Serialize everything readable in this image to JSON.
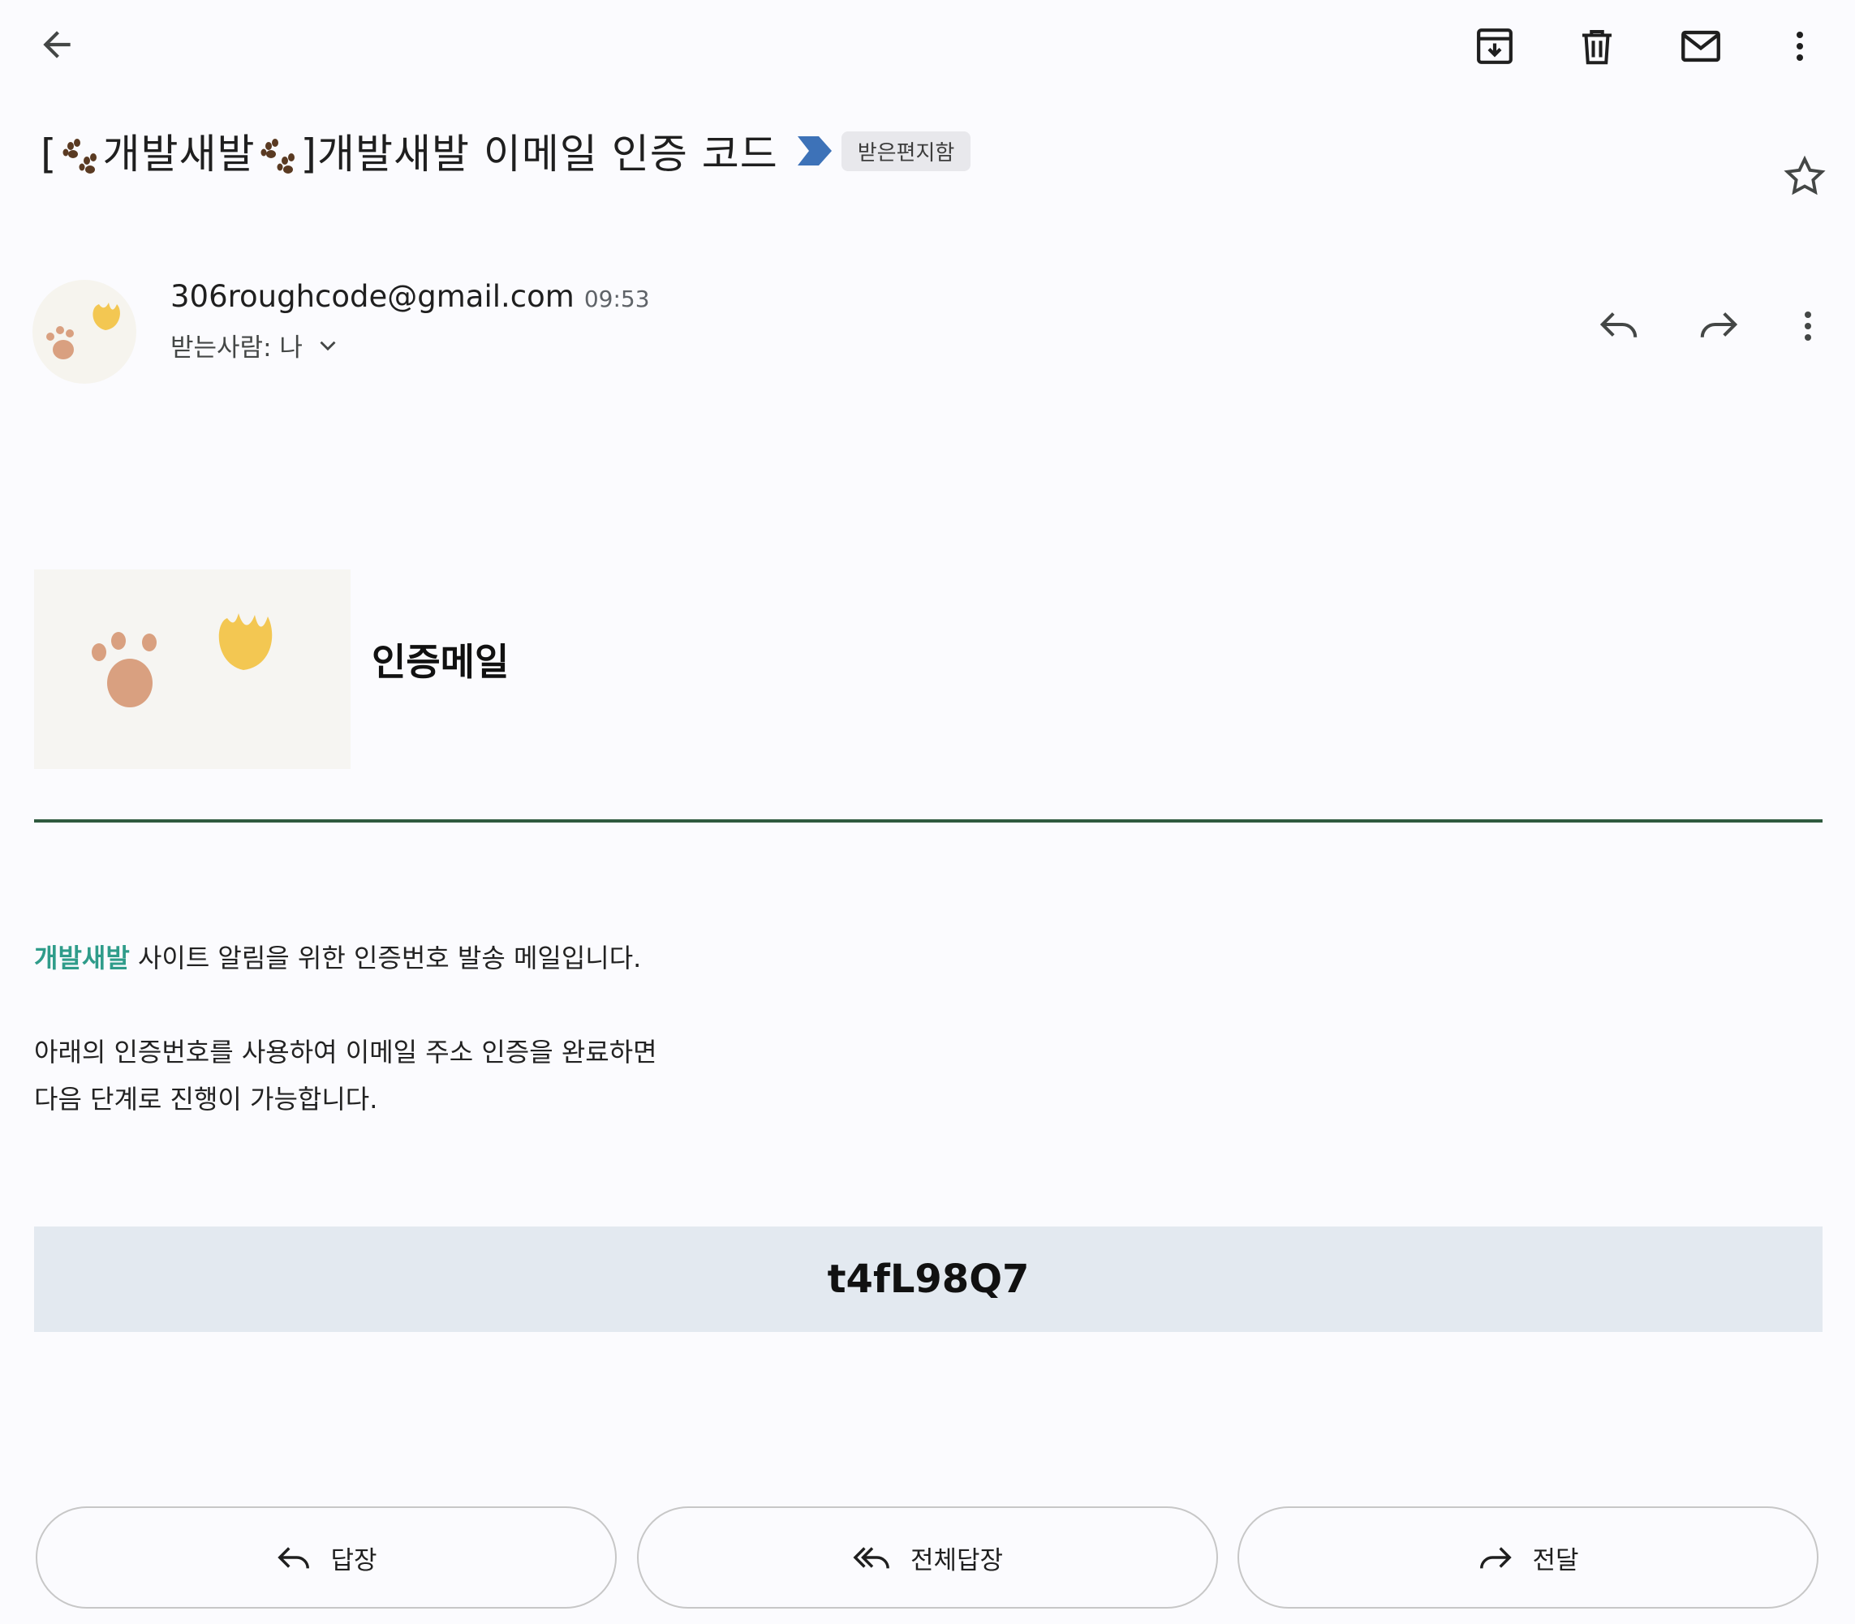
{
  "toolbar": {
    "back_icon": "arrow-left-icon",
    "archive_icon": "archive-icon",
    "delete_icon": "trash-icon",
    "mark_unread_icon": "mail-icon",
    "more_icon": "more-vert-icon"
  },
  "email": {
    "subject_prefix_open": "[",
    "subject_brand": "개발새발",
    "subject_prefix_close": "]",
    "subject_text": "개발새발 이메일 인증 코드",
    "label": "받은편지함",
    "starred": false,
    "sender": "306roughcode@gmail.com",
    "time": "09:53",
    "recipient": "받는사람: 나"
  },
  "body": {
    "title": "인증메일",
    "brand_word": "개발새발",
    "line1_rest": " 사이트 알림을 위한 인증번호 발송 메일입니다.",
    "line2": "아래의 인증번호를 사용하여 이메일 주소 인증을 완료하면",
    "line3": "다음 단계로 진행이 가능합니다.",
    "code": "t4fL98Q7"
  },
  "actions": {
    "reply": "답장",
    "reply_all": "전체답장",
    "forward": "전달"
  },
  "colors": {
    "brand_teal": "#2f9c8a",
    "divider_green": "#2f5a3f",
    "code_bg": "#e3e9f0",
    "importance_blue": "#3d72b8"
  }
}
